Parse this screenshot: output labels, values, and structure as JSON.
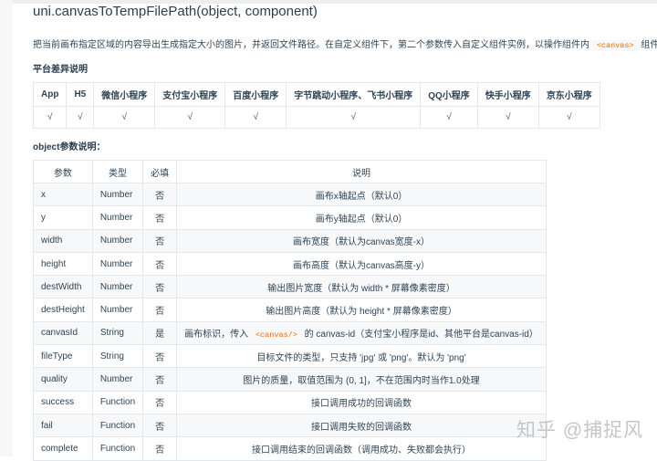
{
  "title": "uni.canvasToTempFilePath(object, component)",
  "intro": {
    "before": "把当前画布指定区域的内容导出生成指定大小的图片，并返回文件路径。在自定义组件下，第二个参数传入自定义组件实例，以操作组件内 ",
    "code": "<canvas>",
    "after": " 组件。"
  },
  "platform_heading": "平台差异说明",
  "platforms": [
    "App",
    "H5",
    "微信小程序",
    "支付宝小程序",
    "百度小程序",
    "字节跳动小程序、飞书小程序",
    "QQ小程序",
    "快手小程序",
    "京东小程序"
  ],
  "support": [
    "√",
    "√",
    "√",
    "√",
    "√",
    "√",
    "√",
    "√",
    "√"
  ],
  "object_heading": "object参数说明：",
  "param_headers": [
    "参数",
    "类型",
    "必填",
    "说明"
  ],
  "params": [
    [
      "x",
      "Number",
      "否",
      "画布x轴起点（默认0）"
    ],
    [
      "y",
      "Number",
      "否",
      "画布y轴起点（默认0）"
    ],
    [
      "width",
      "Number",
      "否",
      "画布宽度（默认为canvas宽度-x）"
    ],
    [
      "height",
      "Number",
      "否",
      "画布高度（默认为canvas高度-y）"
    ],
    [
      "destWidth",
      "Number",
      "否",
      "输出图片宽度（默认为 width * 屏幕像素密度）"
    ],
    [
      "destHeight",
      "Number",
      "否",
      "输出图片高度（默认为 height * 屏幕像素密度）"
    ],
    [
      "canvasId",
      "String",
      "是",
      "画布标识，传入 "
    ],
    [
      "fileType",
      "String",
      "否",
      "目标文件的类型，只支持 'jpg' 或 'png'。默认为 'png'"
    ],
    [
      "quality",
      "Number",
      "否",
      "图片的质量，取值范围为 (0, 1]，不在范围内时当作1.0处理"
    ],
    [
      "success",
      "Function",
      "否",
      "接口调用成功的回调函数"
    ],
    [
      "fail",
      "Function",
      "否",
      "接口调用失败的回调函数"
    ],
    [
      "complete",
      "Function",
      "否",
      "接口调用结束的回调函数（调用成功、失败都会执行）"
    ]
  ],
  "canvasid_code": "<canvas/>",
  "canvasid_after": " 的 canvas-id（支付宝小程序是id、其他平台是canvas-id）",
  "watermark": "知乎 @捕捉风"
}
